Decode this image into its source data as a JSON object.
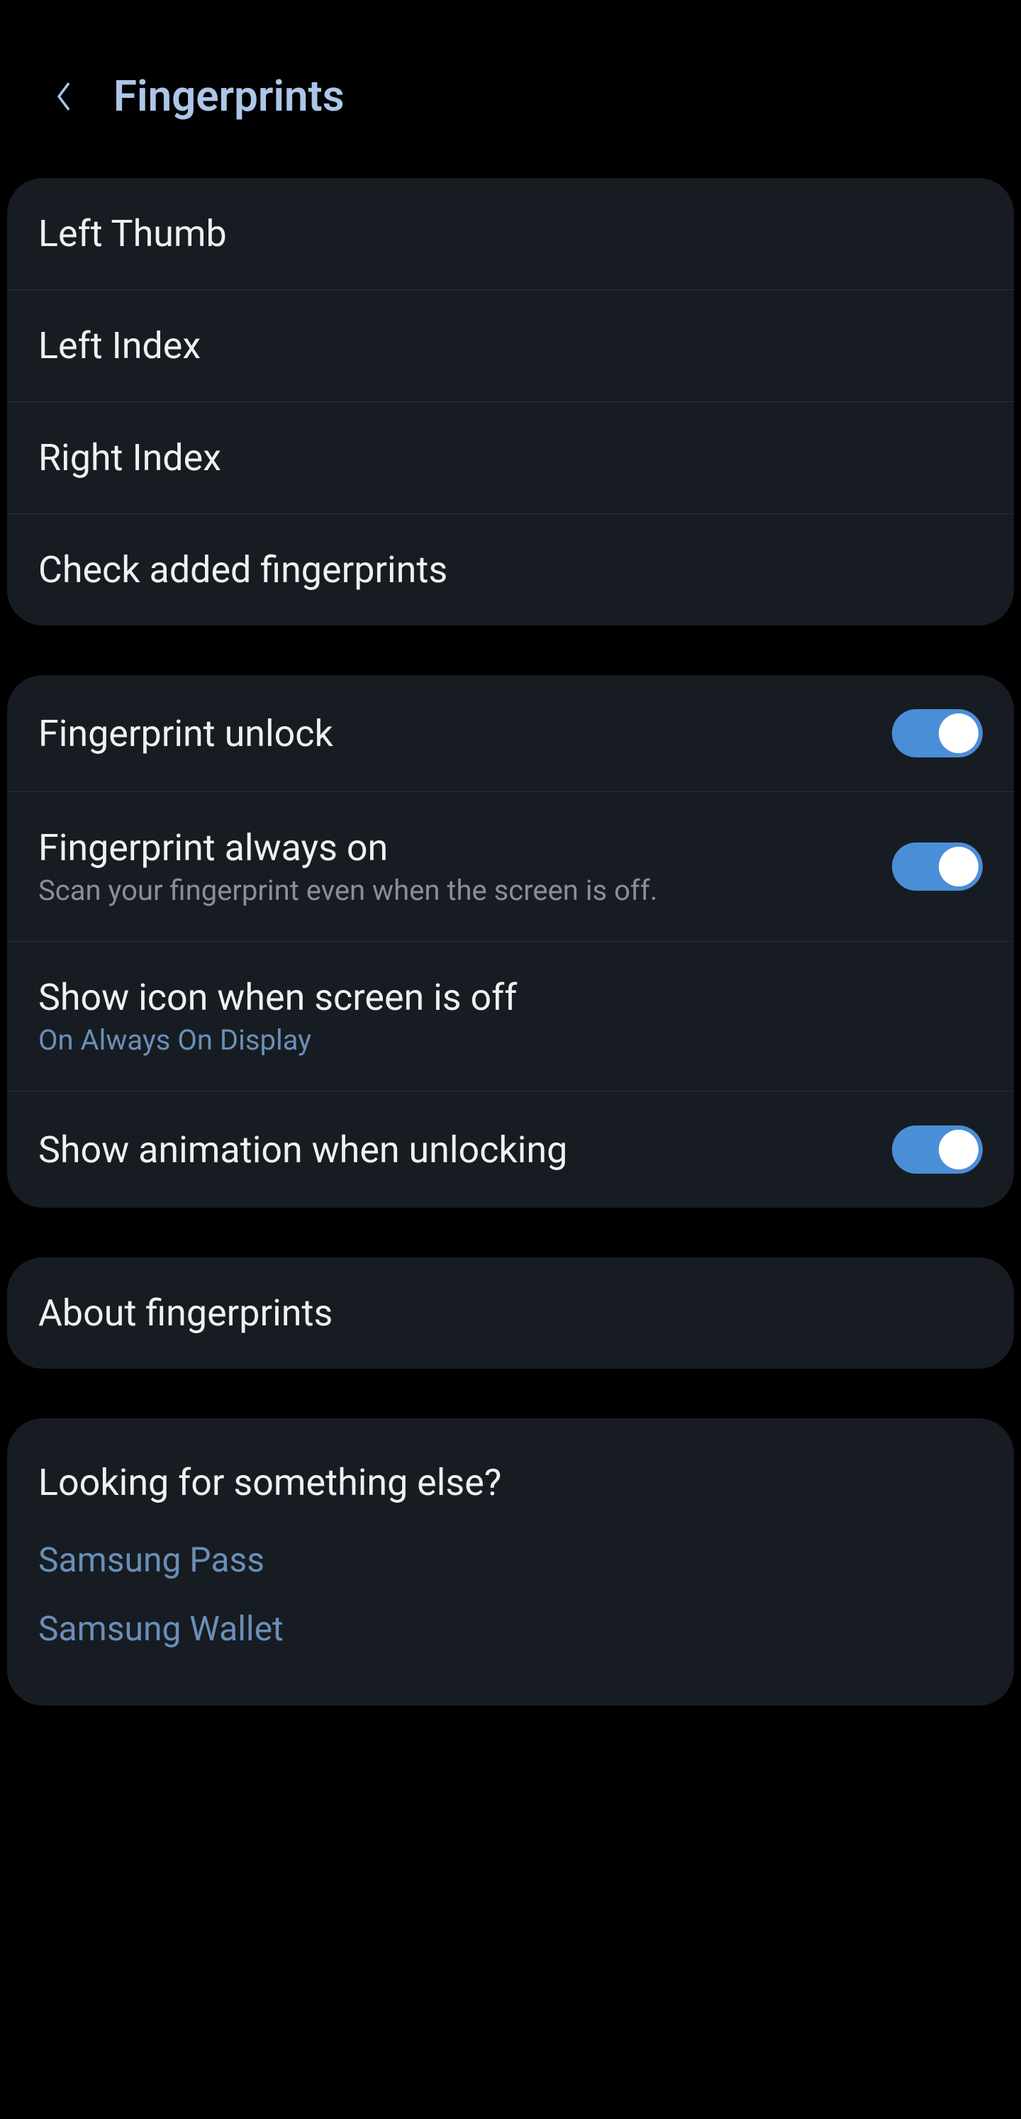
{
  "header": {
    "title": "Fingerprints"
  },
  "fingerprints": {
    "items": [
      {
        "label": "Left Thumb"
      },
      {
        "label": "Left Index"
      },
      {
        "label": "Right Index"
      },
      {
        "label": "Check added fingerprints"
      }
    ]
  },
  "settings": {
    "unlock": {
      "label": "Fingerprint unlock",
      "enabled": true
    },
    "always_on": {
      "label": "Fingerprint always on",
      "sublabel": "Scan your fingerprint even when the screen is off.",
      "enabled": true
    },
    "show_icon": {
      "label": "Show icon when screen is off",
      "sublabel": "On Always On Display"
    },
    "animation": {
      "label": "Show animation when unlocking",
      "enabled": true
    }
  },
  "about": {
    "label": "About fingerprints"
  },
  "footer": {
    "title": "Looking for something else?",
    "links": [
      {
        "label": "Samsung Pass"
      },
      {
        "label": "Samsung Wallet"
      }
    ]
  }
}
